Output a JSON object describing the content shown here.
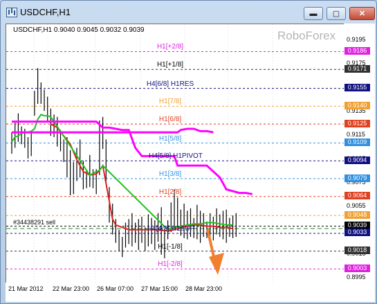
{
  "window": {
    "title": "USDCHF,H1",
    "minimize_icon": "minimize-icon",
    "maximize_icon": "maximize-icon",
    "close_icon": "close-icon",
    "minimize_glyph": "▬",
    "maximize_glyph": "▢",
    "close_glyph": "✕"
  },
  "chart_header": {
    "symbol_ohlc": "USDCHF,H1  0.9040 0.9045 0.9032 0.9039",
    "brand": "RoboForex"
  },
  "order_line": {
    "label": "#34438291 sell",
    "price": 0.9037
  },
  "price_axis": {
    "ticks": [
      "0.9195",
      "0.9175",
      "0.9155",
      "0.9135",
      "0.9115",
      "0.9095",
      "0.9075",
      "0.9055",
      "0.9035",
      "0.9015",
      "0.8995"
    ],
    "range": [
      0.8991,
      0.9209
    ]
  },
  "time_axis": {
    "labels": [
      "21 Mar 2012",
      "22 Mar 23:00",
      "26 Mar 07:00",
      "27 Mar 15:00",
      "28 Mar 23:00"
    ]
  },
  "murrey_levels": [
    {
      "label": "H1[+2/8]",
      "price": 0.9186,
      "tag": "0.9186",
      "color": "#e020e0",
      "tag_bg": "#e020e0",
      "tag_fg": "#ffffff"
    },
    {
      "label": "H1[+1/8]",
      "price": 0.9171,
      "tag": "0.9171",
      "color": "#303030",
      "tag_bg": "#303030",
      "tag_fg": "#ffffff"
    },
    {
      "label": "H4[6/8] H1RES",
      "price": 0.9155,
      "tag": "0.9155",
      "color": "#101080",
      "tag_bg": "#101080",
      "tag_fg": "#ffffff"
    },
    {
      "label": "H1[7/8]",
      "price": 0.914,
      "tag": "0.9140",
      "color": "#f0a030",
      "tag_bg": "#f0a030",
      "tag_fg": "#ffffff"
    },
    {
      "label": "H1[6/8]",
      "price": 0.9125,
      "tag": "0.9125",
      "color": "#e04020",
      "tag_bg": "#e04020",
      "tag_fg": "#ffffff"
    },
    {
      "label": "H1[5/8]",
      "price": 0.9109,
      "tag": "0.9109",
      "color": "#3090e0",
      "tag_bg": "#3090e0",
      "tag_fg": "#ffffff"
    },
    {
      "label": "H4[5/8] H1PIVOT",
      "price": 0.9094,
      "tag": "0.9094",
      "color": "#101080",
      "tag_bg": "#101080",
      "tag_fg": "#ffffff"
    },
    {
      "label": "H1[3/8]",
      "price": 0.9079,
      "tag": "0.9079",
      "color": "#3090e0",
      "tag_bg": "#3090e0",
      "tag_fg": "#ffffff"
    },
    {
      "label": "H1[2/8]",
      "price": 0.9064,
      "tag": "0.9064",
      "color": "#e04020",
      "tag_bg": "#e04020",
      "tag_fg": "#ffffff"
    },
    {
      "label": "",
      "price": 0.9048,
      "tag": "0.9048",
      "color": "#f0a030",
      "tag_bg": "#f0a030",
      "tag_fg": "#ffffff"
    },
    {
      "label": "",
      "price": 0.9039,
      "tag": "0.9039",
      "color": "#000000",
      "tag_bg": "#000000",
      "tag_fg": "#ffffff"
    },
    {
      "label": "H4[4/8] H1SUP",
      "price": 0.9033,
      "tag": "0.9033",
      "color": "#101080",
      "tag_bg": "#101080",
      "tag_fg": "#ffffff"
    },
    {
      "label": "H1[-1/8]",
      "price": 0.9018,
      "tag": "0.9018",
      "color": "#303030",
      "tag_bg": "#303030",
      "tag_fg": "#ffffff"
    },
    {
      "label": "H1[-2/8]",
      "price": 0.9003,
      "tag": "0.9003",
      "color": "#e020e0",
      "tag_bg": "#e020e0",
      "tag_fg": "#ffffff"
    }
  ],
  "chart_data": {
    "type": "line",
    "title": "USDCHF,H1",
    "xlabel": "",
    "ylabel": "",
    "ylim": [
      0.8991,
      0.9209
    ],
    "grid": false,
    "series": [
      {
        "role": "price-bars",
        "color": "#000000",
        "x": [
          0,
          1,
          2,
          3,
          4,
          5,
          6,
          7,
          8,
          9,
          10,
          11,
          12,
          13,
          14,
          15,
          16,
          17,
          18,
          19,
          20,
          21,
          22,
          23,
          24,
          25,
          26,
          27,
          28,
          29,
          30,
          31,
          32,
          33,
          34,
          35,
          36,
          37,
          38,
          39,
          40,
          41,
          42,
          43,
          44,
          45,
          46,
          47,
          48,
          49,
          50,
          51,
          52,
          53,
          54,
          55,
          56,
          57,
          58,
          59,
          60,
          61,
          62,
          63,
          64,
          65,
          66,
          67,
          68,
          69
        ],
        "high": [
          0.9118,
          0.9126,
          0.9134,
          0.9123,
          0.9121,
          0.9114,
          0.9119,
          0.9153,
          0.9172,
          0.916,
          0.9154,
          0.9148,
          0.9138,
          0.9133,
          0.9131,
          0.912,
          0.9112,
          0.9114,
          0.9103,
          0.9093,
          0.9105,
          0.9112,
          0.9094,
          0.9086,
          0.9099,
          0.9087,
          0.9087,
          0.9128,
          0.9131,
          0.9112,
          0.9072,
          0.9058,
          0.9045,
          0.9036,
          0.903,
          0.9042,
          0.9045,
          0.905,
          0.9042,
          0.9045,
          0.9047,
          0.9038,
          0.9049,
          0.9046,
          0.9044,
          0.905,
          0.9055,
          0.9037,
          0.9044,
          0.9059,
          0.907,
          0.9063,
          0.9053,
          0.9058,
          0.9052,
          0.9054,
          0.9046,
          0.9057,
          0.9052,
          0.905,
          0.9043,
          0.905,
          0.9047,
          0.9054,
          0.9049,
          0.9052,
          0.9053,
          0.9046,
          0.9048,
          0.905
        ],
        "low": [
          0.91,
          0.9105,
          0.911,
          0.9108,
          0.9105,
          0.9096,
          0.9098,
          0.9132,
          0.9142,
          0.9142,
          0.9136,
          0.9127,
          0.9115,
          0.9114,
          0.9106,
          0.9102,
          0.9093,
          0.908,
          0.9065,
          0.9066,
          0.9077,
          0.908,
          0.907,
          0.9071,
          0.9072,
          0.9071,
          0.9066,
          0.9082,
          0.9104,
          0.9076,
          0.9042,
          0.9032,
          0.9025,
          0.9018,
          0.9013,
          0.9021,
          0.9024,
          0.9022,
          0.9025,
          0.9019,
          0.9025,
          0.9018,
          0.9022,
          0.9024,
          0.9019,
          0.9026,
          0.9015,
          0.9012,
          0.9028,
          0.9034,
          0.9038,
          0.9036,
          0.9031,
          0.9029,
          0.9028,
          0.903,
          0.9029,
          0.9028,
          0.9025,
          0.903,
          0.9029,
          0.9028,
          0.9027,
          0.9032,
          0.903,
          0.9028,
          0.9025,
          0.903,
          0.9029,
          0.903
        ]
      },
      {
        "role": "red-trend-line",
        "color": "#e02020",
        "x": [
          12,
          14,
          16,
          18,
          20,
          22,
          24,
          26,
          27,
          28,
          29,
          30,
          31,
          32,
          34,
          36,
          40,
          44,
          48,
          50,
          52,
          54,
          56,
          58,
          60,
          62,
          64,
          66,
          68
        ],
        "y": [
          0.9125,
          0.9122,
          0.9115,
          0.9108,
          0.9095,
          0.9085,
          0.9082,
          0.9083,
          0.9086,
          0.909,
          0.9075,
          0.906,
          0.9045,
          0.904,
          0.9038,
          0.9036,
          0.9036,
          0.9036,
          0.9035,
          0.9036,
          0.9038,
          0.9039,
          0.904,
          0.904,
          0.9039,
          0.9039,
          0.9038,
          0.9038,
          0.9037
        ]
      },
      {
        "role": "green-trend-line",
        "color": "#20c020",
        "x": [
          0,
          1,
          2,
          3,
          4,
          5,
          6,
          7,
          8,
          9,
          10,
          11,
          12,
          24,
          26,
          27,
          28,
          48,
          50,
          52,
          54,
          56,
          58,
          60,
          62,
          64,
          66,
          68
        ],
        "y": [
          0.911,
          0.9114,
          0.9115,
          0.9117,
          0.9118,
          0.9118,
          0.9119,
          0.9121,
          0.9129,
          0.9133,
          0.9132,
          0.9132,
          0.9131,
          0.9082,
          0.9085,
          0.9086,
          0.909,
          0.9036,
          0.9038,
          0.9039,
          0.904,
          0.9041,
          0.9041,
          0.9042,
          0.9042,
          0.9041,
          0.904,
          0.904
        ]
      },
      {
        "role": "magenta-range-line",
        "color": "#ff00ff",
        "x": [
          0,
          26,
          28,
          30,
          34,
          36,
          38,
          40,
          50,
          51,
          60,
          64,
          66,
          70,
          71,
          72,
          74
        ],
        "y": [
          0.9127,
          0.9127,
          0.9122,
          0.9122,
          0.912,
          0.912,
          0.9105,
          0.9098,
          0.9098,
          0.909,
          0.909,
          0.908,
          0.907,
          0.9067,
          0.9067,
          0.9067,
          0.9066
        ]
      },
      {
        "role": "magenta-range-line",
        "color": "#ff00ff",
        "x": [
          0,
          51,
          52,
          54,
          56,
          58,
          60,
          62
        ],
        "y": [
          0.9118,
          0.9118,
          0.912,
          0.9121,
          0.9121,
          0.9119,
          0.9119,
          0.9118
        ]
      }
    ]
  }
}
